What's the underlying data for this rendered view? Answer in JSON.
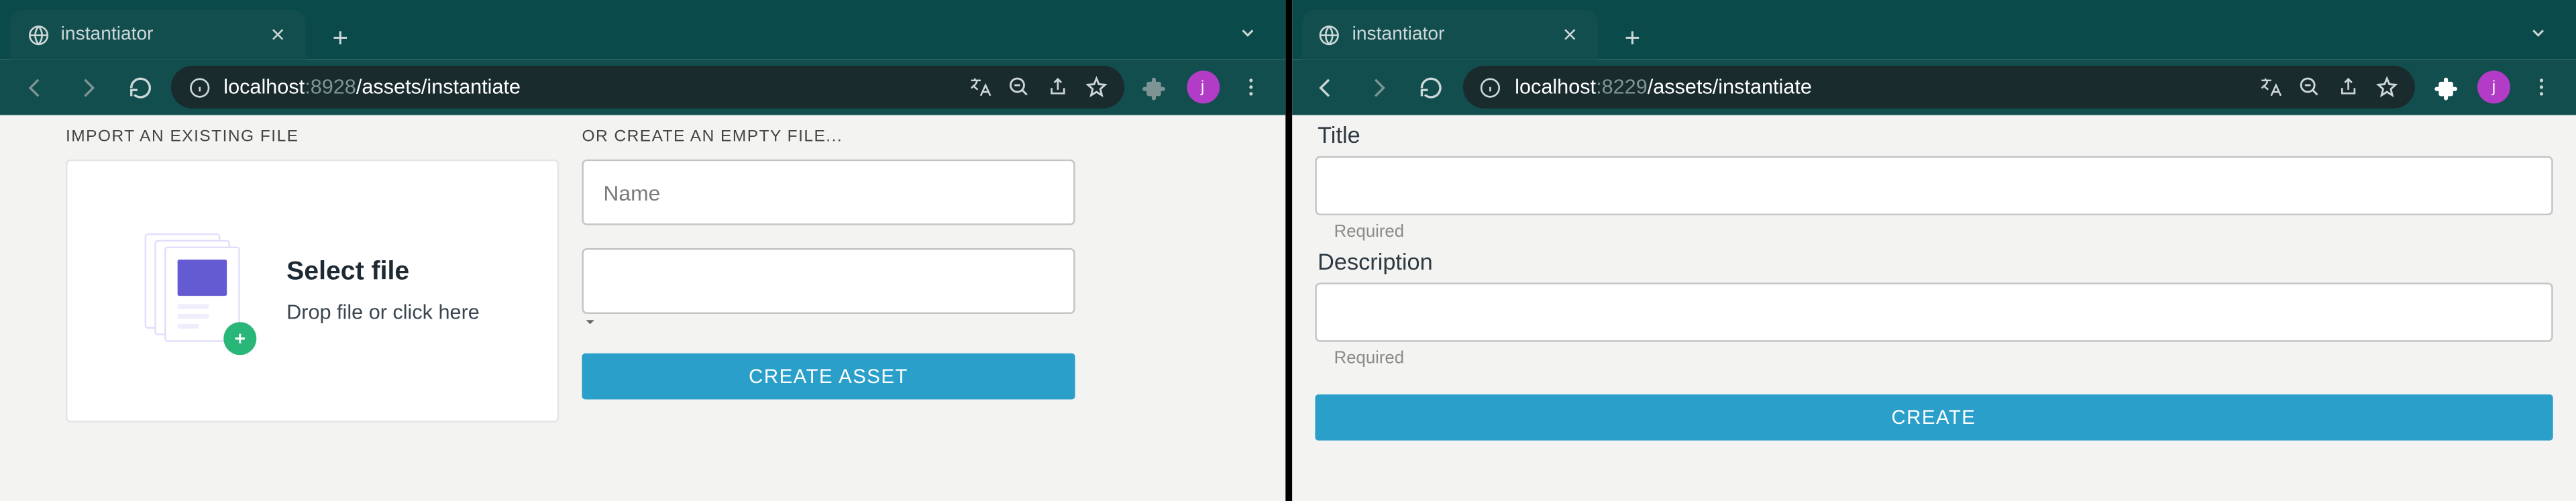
{
  "windowA": {
    "tab": {
      "title": "instantiator"
    },
    "url": {
      "prefix1": "localhost",
      "prefix2": ":8928",
      "path": "/assets/instantiate"
    },
    "avatar": "j",
    "page": {
      "import_label": "IMPORT AN EXISTING FILE",
      "select_file_title": "Select file",
      "select_file_sub": "Drop file or click here",
      "create_label": "OR CREATE AN EMPTY FILE...",
      "name_placeholder": "Name",
      "create_button": "CREATE ASSET"
    }
  },
  "windowB": {
    "tab": {
      "title": "instantiator"
    },
    "url": {
      "prefix1": "localhost",
      "prefix2": ":8229",
      "path": "/assets/instantiate"
    },
    "avatar": "j",
    "page": {
      "title_label": "Title",
      "title_helper": "Required",
      "description_label": "Description",
      "description_helper": "Required",
      "create_button": "CREATE"
    }
  }
}
